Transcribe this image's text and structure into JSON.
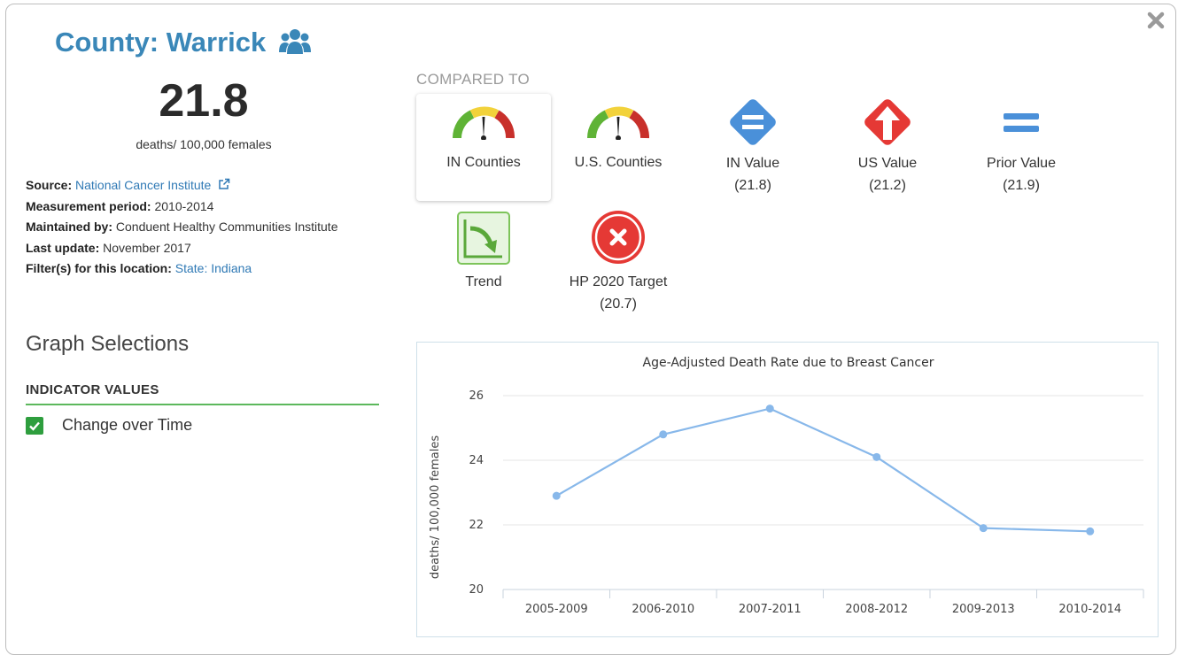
{
  "header": {
    "title": "County: Warrick",
    "title_icon": "group-icon",
    "value": "21.8",
    "units": "deaths/ 100,000 females"
  },
  "meta": {
    "source_label": "Source:",
    "source_value": "National Cancer Institute",
    "period_label": "Measurement period:",
    "period_value": "2010-2014",
    "maintained_label": "Maintained by:",
    "maintained_value": "Conduent Healthy Communities Institute",
    "update_label": "Last update:",
    "update_value": "November 2017",
    "filter_label": "Filter(s) for this location:",
    "filter_value": "State: Indiana"
  },
  "graph_selections": {
    "heading": "Graph Selections",
    "section": "INDICATOR VALUES",
    "checkbox_label": "Change over Time",
    "checked": true
  },
  "compared": {
    "label": "COMPARED TO",
    "items": [
      {
        "label": "IN Counties",
        "sub": "",
        "icon": "gauge-icon",
        "selected": true
      },
      {
        "label": "U.S. Counties",
        "sub": "",
        "icon": "gauge-icon",
        "selected": false
      },
      {
        "label": "IN Value",
        "sub": "(21.8)",
        "icon": "equal-diamond-icon",
        "selected": false
      },
      {
        "label": "US Value",
        "sub": "(21.2)",
        "icon": "arrow-up-diamond-icon",
        "selected": false
      },
      {
        "label": "Prior Value",
        "sub": "(21.9)",
        "icon": "equal-icon",
        "selected": false
      },
      {
        "label": "Trend",
        "sub": "",
        "icon": "trend-down-icon",
        "selected": false
      },
      {
        "label": "HP 2020 Target",
        "sub": "(20.7)",
        "icon": "x-circle-icon",
        "selected": false
      }
    ]
  },
  "colors": {
    "title_blue": "#3a87b8",
    "diamond_blue": "#4a90d9",
    "diamond_red": "#e53935",
    "green": "#5cb85c",
    "line": "#88b8ea"
  },
  "chart_data": {
    "type": "line",
    "title": "Age-Adjusted Death Rate due to Breast Cancer",
    "xlabel": "",
    "ylabel": "deaths/ 100,000 females",
    "categories": [
      "2005-2009",
      "2006-2010",
      "2007-2011",
      "2008-2012",
      "2009-2013",
      "2010-2014"
    ],
    "series": [
      {
        "values": [
          22.9,
          24.8,
          25.6,
          24.1,
          21.9,
          21.8
        ]
      }
    ],
    "ylim": [
      20,
      26
    ],
    "yticks": [
      20,
      22,
      24,
      26
    ],
    "grid": true
  }
}
